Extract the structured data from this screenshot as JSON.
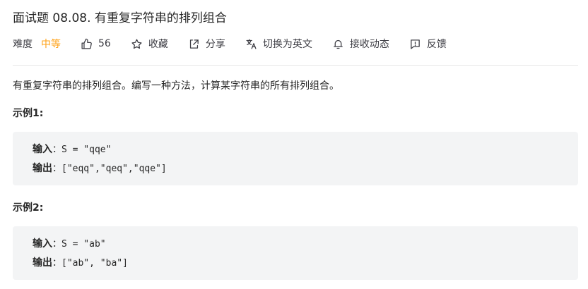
{
  "problem": {
    "title": "面试题 08.08. 有重复字符串的排列组合"
  },
  "toolbar": {
    "difficulty_label": "难度",
    "difficulty_value": "中等",
    "likes": "56",
    "favorite_label": "收藏",
    "share_label": "分享",
    "switch_lang_label": "切换为英文",
    "notify_label": "接收动态",
    "feedback_label": "反馈",
    "icons": [
      "thumbs-up-icon",
      "star-icon",
      "share-icon",
      "translate-icon",
      "bell-icon",
      "feedback-icon"
    ],
    "difficulty_color": "#ffa116"
  },
  "description": "有重复字符串的排列组合。编写一种方法，计算某字符串的所有排列组合。",
  "examples": [
    {
      "title": "示例1:",
      "input_label": "输入",
      "input_value": "：S = \"qqe\"",
      "output_label": "输出",
      "output_value": "：[\"eqq\",\"qeq\",\"qqe\"]"
    },
    {
      "title": "示例2:",
      "input_label": "输入",
      "input_value": "：S = \"ab\"",
      "output_label": "输出",
      "output_value": "：[\"ab\", \"ba\"]"
    }
  ]
}
